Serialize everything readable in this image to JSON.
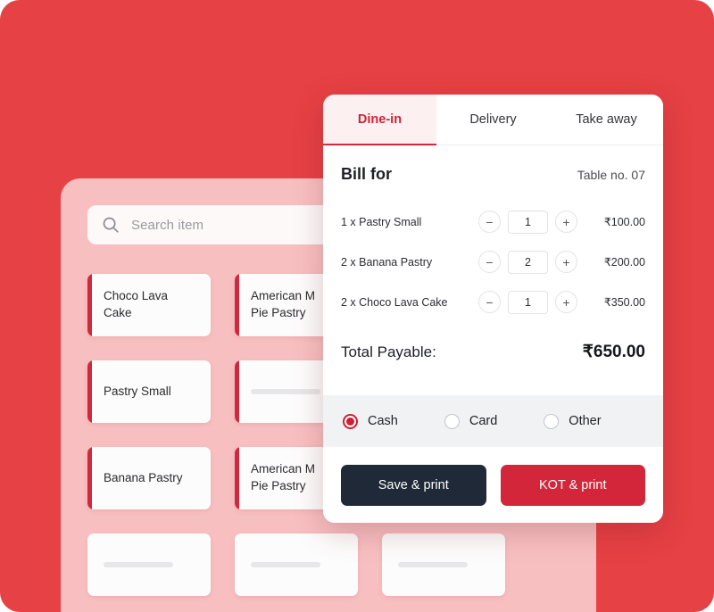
{
  "theme": {
    "brand_red": "#E64145",
    "accent_red": "#D3263B",
    "panel_pink": "#F8BFC1",
    "dark_button": "#1F2937",
    "pay_strip_gray": "#F1F2F4"
  },
  "menu_panel": {
    "search": {
      "icon": "search-icon",
      "placeholder": "Search item",
      "value": ""
    },
    "cards": [
      {
        "label": "Choco Lava\nCake",
        "accent": true,
        "placeholder": false
      },
      {
        "label": "American M\nPie Pastry",
        "accent": true,
        "placeholder": false
      },
      {
        "label": "",
        "accent": true,
        "placeholder": false
      },
      {
        "label": "Pastry Small",
        "accent": true,
        "placeholder": false
      },
      {
        "label": "",
        "accent": true,
        "placeholder": true
      },
      {
        "label": "",
        "accent": true,
        "placeholder": true
      },
      {
        "label": "Banana Pastry",
        "accent": true,
        "placeholder": false
      },
      {
        "label": "American M\nPie Pastry",
        "accent": true,
        "placeholder": false
      },
      {
        "label": "",
        "accent": true,
        "placeholder": true
      },
      {
        "label": "",
        "accent": false,
        "placeholder": true
      },
      {
        "label": "",
        "accent": false,
        "placeholder": true
      },
      {
        "label": "",
        "accent": false,
        "placeholder": true
      }
    ]
  },
  "bill_dialog": {
    "tabs": [
      {
        "label": "Dine-in",
        "active": true
      },
      {
        "label": "Delivery",
        "active": false
      },
      {
        "label": "Take away",
        "active": false
      }
    ],
    "header": {
      "title": "Bill for",
      "table_no": "Table no. 07"
    },
    "items": [
      {
        "name": "1 x Pastry Small",
        "qty": "1",
        "price": "₹100.00",
        "minus": "−",
        "plus": "+"
      },
      {
        "name": "2 x Banana Pastry",
        "qty": "2",
        "price": "₹200.00",
        "minus": "−",
        "plus": "+"
      },
      {
        "name": "2 x Choco Lava Cake",
        "qty": "1",
        "price": "₹350.00",
        "minus": "−",
        "plus": "+"
      }
    ],
    "total": {
      "label": "Total Payable:",
      "value": "₹650.00"
    },
    "payment_methods": [
      {
        "label": "Cash",
        "selected": true
      },
      {
        "label": "Card",
        "selected": false
      },
      {
        "label": "Other",
        "selected": false
      }
    ],
    "actions": {
      "save_label": "Save & print",
      "kot_label": "KOT & print"
    }
  }
}
